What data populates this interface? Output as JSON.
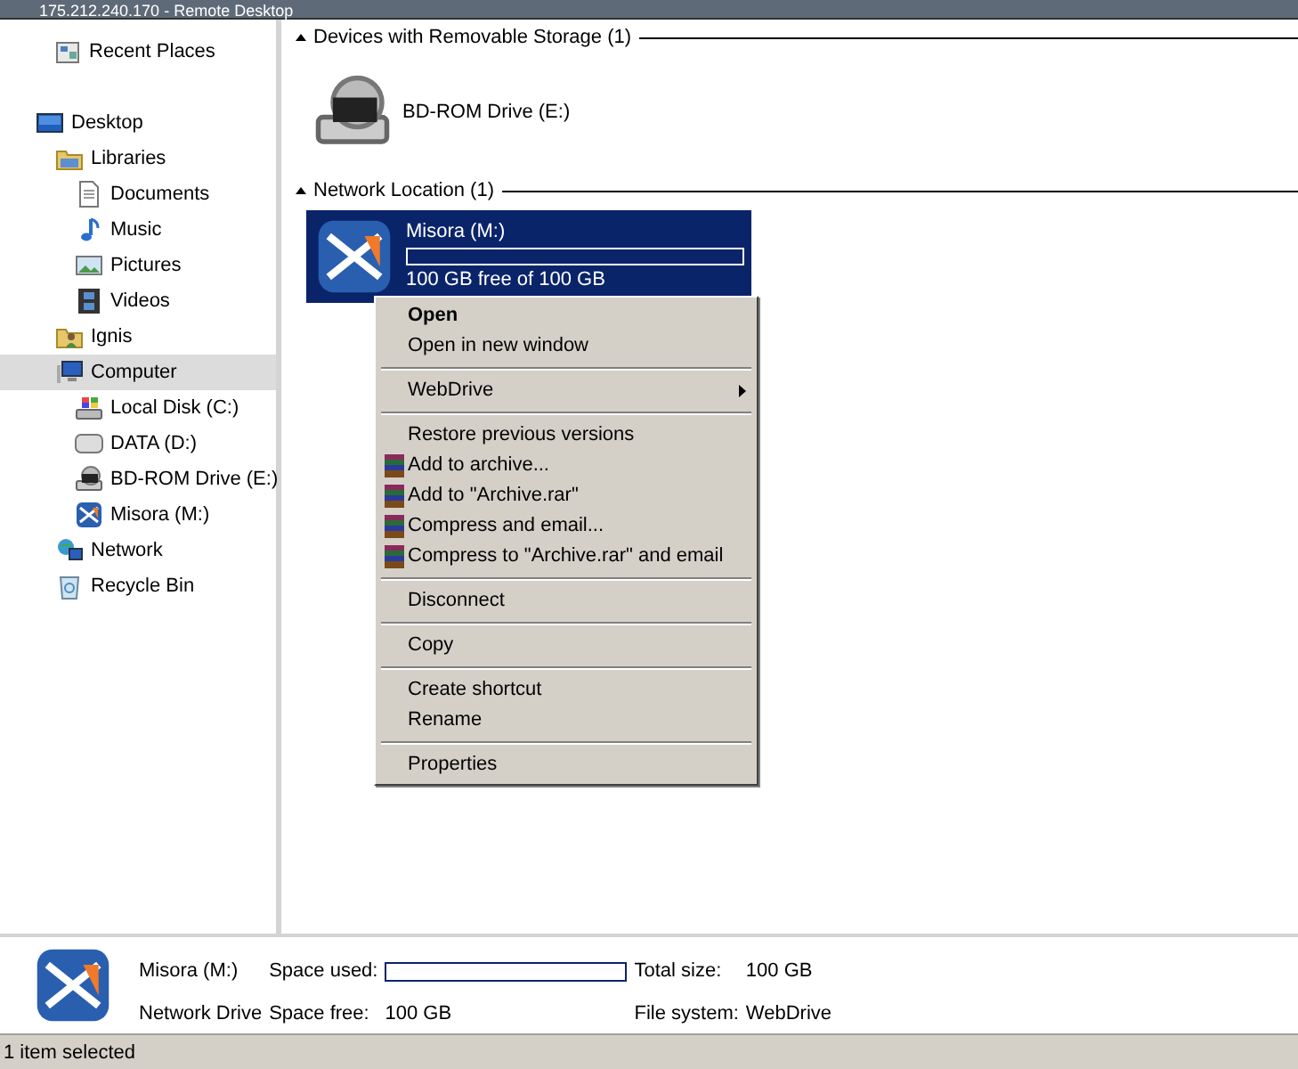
{
  "window": {
    "title": "175.212.240.170 - Remote Desktop"
  },
  "sidebar": {
    "items": [
      {
        "label": "Recent Places",
        "kind": "recent",
        "selected": false
      },
      {
        "kind": "gap"
      },
      {
        "label": "Desktop",
        "kind": "desktop",
        "selected": false,
        "children": [
          {
            "label": "Libraries",
            "kind": "library",
            "selected": false,
            "children": [
              {
                "label": "Documents",
                "kind": "document",
                "selected": false
              },
              {
                "label": "Music",
                "kind": "music",
                "selected": false
              },
              {
                "label": "Pictures",
                "kind": "picture",
                "selected": false
              },
              {
                "label": "Videos",
                "kind": "video",
                "selected": false
              }
            ]
          },
          {
            "label": "Ignis",
            "kind": "user",
            "selected": false
          },
          {
            "label": "Computer",
            "kind": "computer",
            "selected": true,
            "children": [
              {
                "label": "Local Disk (C:)",
                "kind": "sysdisk",
                "selected": false
              },
              {
                "label": "DATA (D:)",
                "kind": "disk",
                "selected": false
              },
              {
                "label": "BD-ROM Drive (E:)",
                "kind": "bd",
                "selected": false
              },
              {
                "label": "Misora (M:)",
                "kind": "webdrive",
                "selected": false
              }
            ]
          },
          {
            "label": "Network",
            "kind": "network",
            "selected": false
          },
          {
            "label": "Recycle Bin",
            "kind": "recycle",
            "selected": false
          }
        ]
      }
    ]
  },
  "groups": [
    {
      "header": "Devices with Removable Storage (1)",
      "items": [
        {
          "kind": "bd",
          "name": "BD-ROM Drive (E:)",
          "selected": false
        }
      ]
    },
    {
      "header": "Network Location (1)",
      "items": [
        {
          "kind": "webdrive",
          "name": "Misora (M:)",
          "selected": true,
          "level": 0,
          "free": "100 GB free of 100 GB"
        }
      ]
    }
  ],
  "context_menu": {
    "sections": [
      [
        {
          "label": "Open",
          "kind": "plain",
          "default": true
        },
        {
          "label": "Open in new window",
          "kind": "plain",
          "default": false
        }
      ],
      [
        {
          "label": "WebDrive",
          "kind": "submenu",
          "default": false
        }
      ],
      [
        {
          "label": "Restore previous versions",
          "kind": "plain",
          "default": false
        },
        {
          "label": "Add to archive...",
          "kind": "archive",
          "default": false
        },
        {
          "label": "Add to \"Archive.rar\"",
          "kind": "archive",
          "default": false
        },
        {
          "label": "Compress and email...",
          "kind": "archive",
          "default": false
        },
        {
          "label": "Compress to \"Archive.rar\" and email",
          "kind": "archive",
          "default": false
        }
      ],
      [
        {
          "label": "Disconnect",
          "kind": "plain",
          "default": false
        }
      ],
      [
        {
          "label": "Copy",
          "kind": "plain",
          "default": false
        }
      ],
      [
        {
          "label": "Create shortcut",
          "kind": "plain",
          "default": false
        },
        {
          "label": "Rename",
          "kind": "plain",
          "default": false
        }
      ],
      [
        {
          "label": "Properties",
          "kind": "plain",
          "default": false
        }
      ]
    ]
  },
  "details": {
    "kind": "webdrive",
    "name": "Misora (M:)",
    "type": "Network Drive",
    "space_used_label": "Space used:",
    "level": 0,
    "space_free_label": "Space free:",
    "space_free": "100 GB",
    "total_size_label": "Total size:",
    "total_size": "100 GB",
    "file_system_label": "File system:",
    "file_system": "WebDrive"
  },
  "status_bar": "1 item selected"
}
